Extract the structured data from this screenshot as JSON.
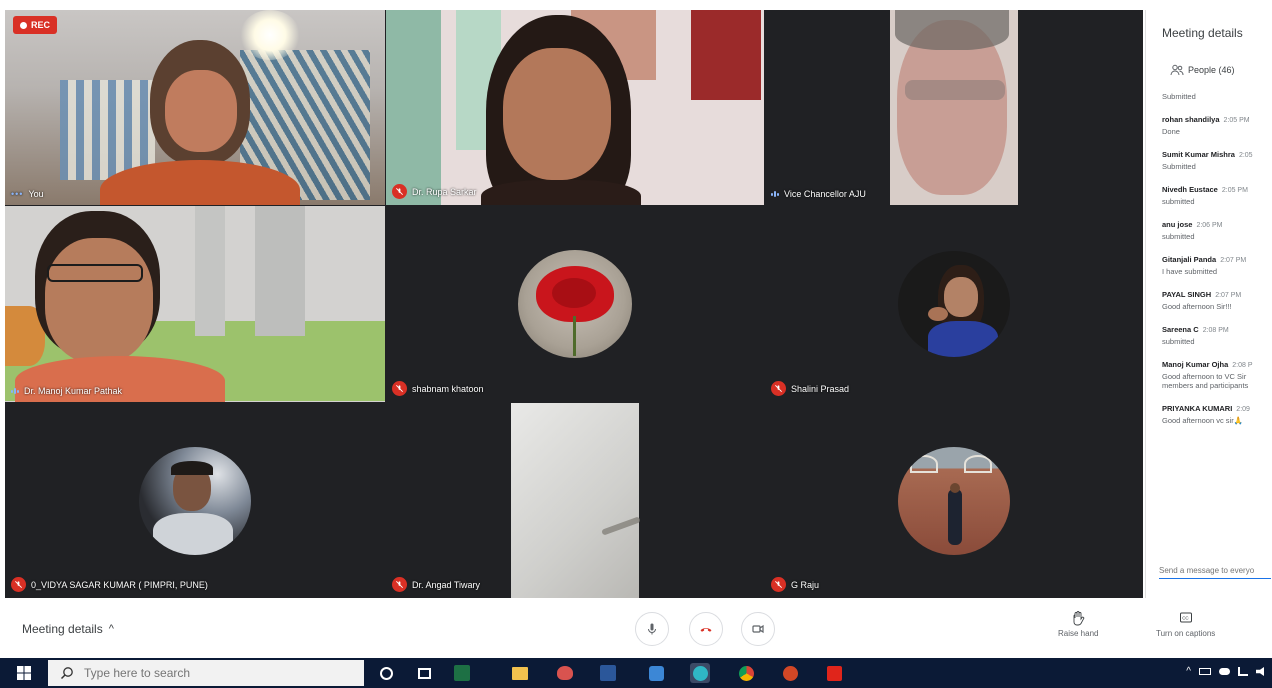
{
  "recording": {
    "label": "REC"
  },
  "tiles": {
    "you": "You",
    "rupa": "Dr. Rupa Sarkar",
    "vc": "Vice Chancellor AJU",
    "manoj": "Dr. Manoj Kumar Pathak",
    "shabnam": "shabnam khatoon",
    "shalini": "Shalini Prasad",
    "vidya": "0_VIDYA SAGAR KUMAR ( PIMPRI, PUNE)",
    "angad": "Dr. Angad Tiwary",
    "graju": "G Raju"
  },
  "panel": {
    "title": "Meeting details",
    "people": "People (46)",
    "top_text": "Submitted",
    "messages": [
      {
        "who": "rohan shandilya",
        "time": "2:05 PM",
        "text": "Done"
      },
      {
        "who": "Sumit Kumar Mishra",
        "time": "2:05",
        "text": "Submitted"
      },
      {
        "who": "Nivedh Eustace",
        "time": "2:05 PM",
        "text": "submitted"
      },
      {
        "who": "anu jose",
        "time": "2:06 PM",
        "text": "submitted"
      },
      {
        "who": "Gitanjali Panda",
        "time": "2:07 PM",
        "text": "I have submitted"
      },
      {
        "who": "PAYAL SINGH",
        "time": "2:07 PM",
        "text": "Good afternoon Sir!!!"
      },
      {
        "who": "Sareena C",
        "time": "2:08 PM",
        "text": "submitted"
      },
      {
        "who": "Manoj Kumar Ojha",
        "time": "2:08 P",
        "text": "Good afternoon to VC Sir members and participants"
      },
      {
        "who": "PRIYANKA KUMARI",
        "time": "2:09",
        "text": "Good afternoon vc sir🙏"
      }
    ],
    "send_placeholder": "Send a message to everyo"
  },
  "bottombar": {
    "meeting_details": "Meeting details",
    "chevron": "^",
    "raise_hand": "Raise hand",
    "captions": "Turn on captions"
  },
  "taskbar": {
    "search_placeholder": "Type here to search"
  },
  "colors": {
    "grid_bg": "#202124",
    "mic_off": "#d93025",
    "accent": "#1a73e8",
    "taskbar": "#0b1a36"
  }
}
